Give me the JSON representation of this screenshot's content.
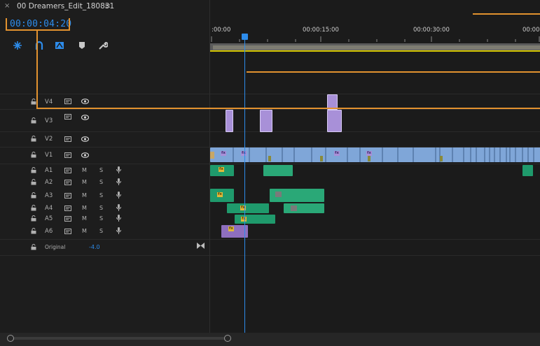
{
  "tab": {
    "close": "×",
    "title": "00 Dreamers_Edit_180831",
    "menu": "≡"
  },
  "timecode": "00:00:04:20",
  "ruler": {
    "labels": [
      ":00:00",
      "00:00:15:00",
      "00:00:30:00",
      "00:00"
    ]
  },
  "tools": [
    "snap-icon",
    "linked-selection-icon",
    "add-marker-icon",
    "marker-icon",
    "wrench-icon"
  ],
  "tracks": {
    "video": [
      {
        "name": "V4"
      },
      {
        "name": "V3"
      },
      {
        "name": "V2"
      },
      {
        "name": "V1"
      }
    ],
    "audio": [
      {
        "name": "A1",
        "m": "M",
        "s": "S"
      },
      {
        "name": "A2",
        "m": "M",
        "s": "S"
      },
      {
        "name": "A3",
        "m": "M",
        "s": "S"
      },
      {
        "name": "A4",
        "m": "M",
        "s": "S"
      },
      {
        "name": "A5",
        "m": "M",
        "s": "S"
      },
      {
        "name": "A6",
        "m": "M",
        "s": "S"
      }
    ],
    "master": {
      "name": "Original",
      "value": "-4.0"
    }
  },
  "fx_label": "fx",
  "colors": {
    "accent": "#2d8ceb",
    "annotation": "#e2922f",
    "video_clip": "#a890d8",
    "v1_clip": "#7fa6d8",
    "audio_clip": "#1f9a6c"
  }
}
